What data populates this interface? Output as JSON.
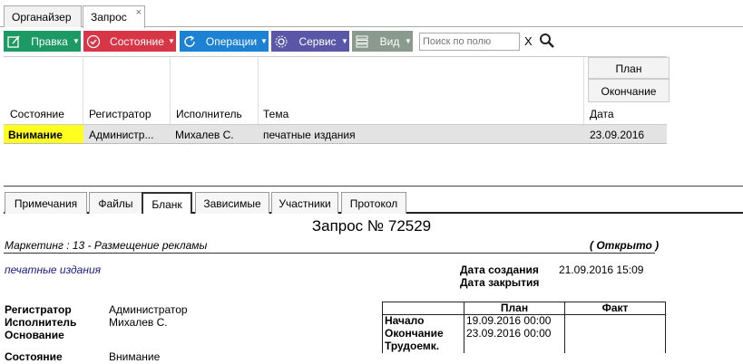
{
  "top_tabs": [
    {
      "label": "Органайзер"
    },
    {
      "label": "Запрос",
      "close": "×"
    }
  ],
  "toolbar": {
    "edit": "Правка",
    "state": "Состояние",
    "operations": "Операции",
    "service": "Сервис",
    "view": "Вид",
    "search_placeholder": "Поиск по полю",
    "clear": "X"
  },
  "colors": {
    "edit": "#1d9a63",
    "state": "#d83646",
    "operations": "#1d82d4",
    "service": "#5b57a8",
    "view": "#8a9a8e",
    "attention": "#ffff1f"
  },
  "grid": {
    "headers": {
      "state": "Состояние",
      "registrar": "Регистратор",
      "executor": "Исполнитель",
      "topic": "Тема",
      "plan": "План",
      "end": "Окончание",
      "date": "Дата"
    },
    "row": {
      "state": "Внимание",
      "registrar": "Администр...",
      "executor": "Михалев С.",
      "topic": "печатные издания",
      "date": "23.09.2016"
    }
  },
  "bottom_tabs": [
    {
      "label": "Примечания"
    },
    {
      "label": "Файлы"
    },
    {
      "label": "Бланк"
    },
    {
      "label": "Зависимые"
    },
    {
      "label": "Участники"
    },
    {
      "label": "Протокол"
    }
  ],
  "doc": {
    "title": "Запрос № 72529",
    "subtitle": "Маркетинг : 13 - Размещение рекламы",
    "status": "( Открыто )",
    "topic": "печатные издания",
    "created_label": "Дата создания",
    "created_value": "21.09.2016 15:09",
    "closed_label": "Дата закрытия",
    "registrar_label": "Регистратор",
    "registrar_value": "Администратор",
    "executor_label": "Исполнитель",
    "executor_value": "Михалев С.",
    "basis_label": "Основание",
    "state_label": "Состояние",
    "state_value": "Внимание",
    "table": {
      "col_plan": "План",
      "col_fact": "Факт",
      "start_label": "Начало",
      "start_plan": "19.09.2016 00:00",
      "end_label": "Окончание",
      "end_plan": "23.09.2016 00:00",
      "labor_label": "Трудоемк."
    }
  }
}
